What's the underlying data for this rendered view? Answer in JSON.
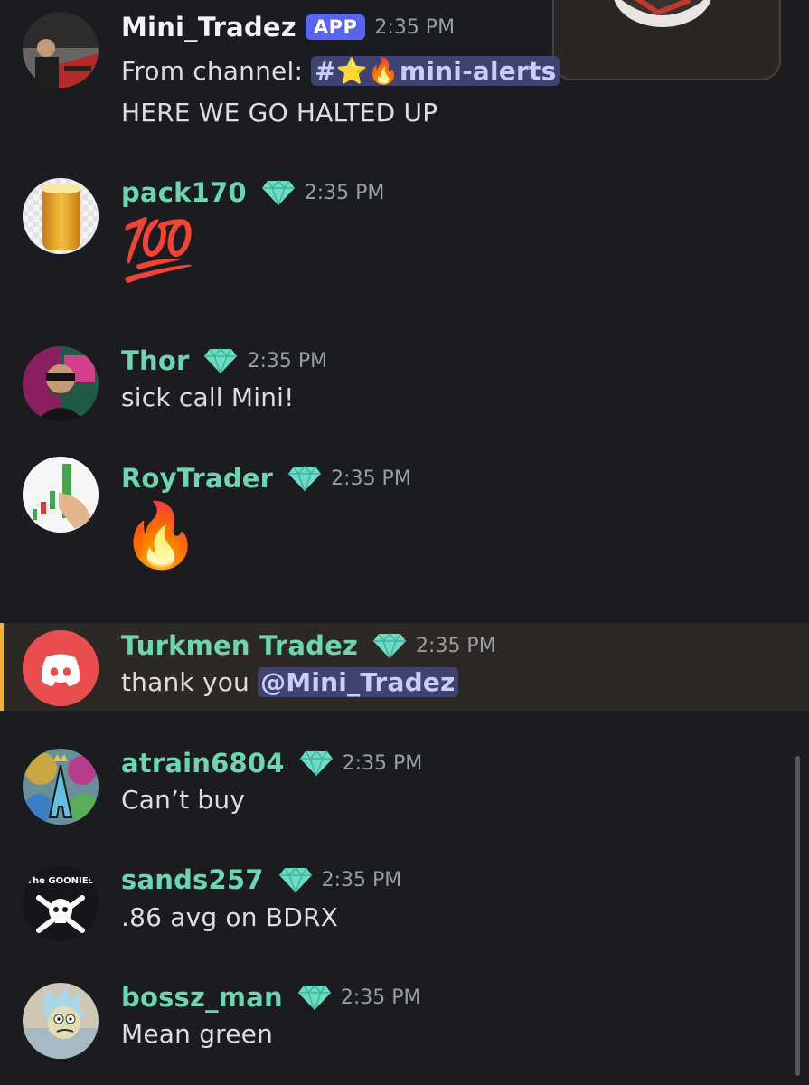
{
  "video_overlay": {
    "icon": "video-thumbnail"
  },
  "messages": [
    {
      "username": "Mini_Tradez",
      "badge": "APP",
      "time": "2:35 PM",
      "line1_prefix": "From channel: ",
      "channel_name": "#⭐🔥mini-alerts",
      "line2": "HERE WE GO HALTED UP"
    },
    {
      "username": "pack170",
      "badge_icon": "gem-icon",
      "time": "2:35 PM",
      "emoji": "💯"
    },
    {
      "username": "Thor",
      "badge_icon": "gem-icon",
      "time": "2:35 PM",
      "text": "sick call Mini!"
    },
    {
      "username": "RoyTrader",
      "badge_icon": "gem-icon",
      "time": "2:35 PM",
      "emoji": "🔥"
    },
    {
      "username": "Turkmen Tradez",
      "badge_icon": "gem-icon",
      "time": "2:35 PM",
      "text_prefix": "thank you ",
      "mention": "@Mini_Tradez",
      "highlight_color": "#f0b232"
    },
    {
      "username": "atrain6804",
      "badge_icon": "gem-icon",
      "time": "2:35 PM",
      "text": "Can’t buy"
    },
    {
      "username": "sands257",
      "badge_icon": "gem-icon",
      "time": "2:35 PM",
      "text": ".86 avg on BDRX",
      "avatar_text": "The GOONIES"
    },
    {
      "username": "bossz_man",
      "badge_icon": "gem-icon",
      "time": "2:35 PM",
      "text": "Mean green"
    }
  ],
  "colors": {
    "background": "#1b1c20",
    "username_green": "#6cd6b0",
    "app_badge": "#5865f2",
    "mention_bg": "#3e4370"
  }
}
